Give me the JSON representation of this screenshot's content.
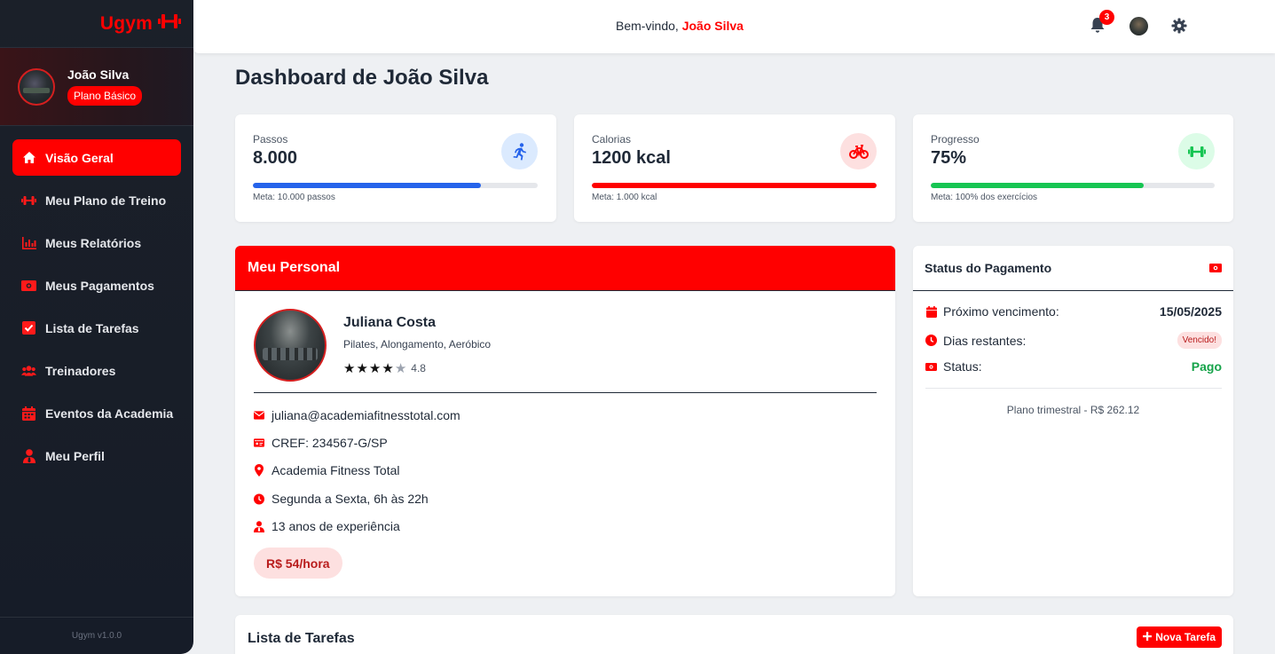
{
  "sidebar": {
    "brand": "Ugym",
    "user": {
      "name": "João Silva",
      "plan": "Plano Básico"
    },
    "items": [
      {
        "label": "Visão Geral",
        "icon": "home-icon",
        "active": true
      },
      {
        "label": "Meu Plano de Treino",
        "icon": "dumbbell-icon"
      },
      {
        "label": "Meus Relatórios",
        "icon": "chart-icon"
      },
      {
        "label": "Meus Pagamentos",
        "icon": "money-icon"
      },
      {
        "label": "Lista de Tarefas",
        "icon": "checkbox-icon"
      },
      {
        "label": "Treinadores",
        "icon": "users-icon"
      },
      {
        "label": "Eventos da Academia",
        "icon": "calendar-icon"
      },
      {
        "label": "Meu Perfil",
        "icon": "user-tie-icon"
      }
    ],
    "version": "Ugym v1.0.0"
  },
  "topbar": {
    "welcome_prefix": "Bem-vindo,",
    "welcome_name": "João Silva",
    "notification_count": "3"
  },
  "page": {
    "title": "Dashboard de João Silva"
  },
  "stats": [
    {
      "label": "Passos",
      "value": "8.000",
      "meta": "Meta: 10.000 passos",
      "progress": 0.8,
      "color": "#2563eb",
      "icon_bg": "#dbeafe",
      "icon": "running-icon"
    },
    {
      "label": "Calorias",
      "value": "1200 kcal",
      "meta": "Meta: 1.000 kcal",
      "progress": 1.0,
      "color": "#ff0000",
      "icon_bg": "#fde0e0",
      "icon": "bicycle-icon"
    },
    {
      "label": "Progresso",
      "value": "75%",
      "meta": "Meta: 100% dos exercícios",
      "progress": 0.75,
      "color": "#16c552",
      "icon_bg": "#dcfce7",
      "icon": "dumbbell-icon"
    }
  ],
  "personal": {
    "header": "Meu Personal",
    "name": "Juliana Costa",
    "specialties": "Pilates, Alongamento, Aeróbico",
    "stars": 4,
    "rating": "4.8",
    "email": "juliana@academiafitnesstotal.com",
    "cref": "CREF: 234567-G/SP",
    "location": "Academia Fitness Total",
    "hours": "Segunda a Sexta, 6h às 22h",
    "experience": "13 anos de experiência",
    "price": "R$ 54/hora"
  },
  "payment": {
    "header": "Status do Pagamento",
    "next_due_label": "Próximo vencimento:",
    "next_due_value": "15/05/2025",
    "days_label": "Dias restantes:",
    "days_value": "Vencido!",
    "status_label": "Status:",
    "status_value": "Pago",
    "plan": "Plano trimestral - R$ 262.12"
  },
  "tasks": {
    "title": "Lista de Tarefas",
    "new_label": "Nova Tarefa"
  },
  "colors": {
    "accent": "#ff0000",
    "sidebar": "#1b2029",
    "success": "#16a34a"
  }
}
